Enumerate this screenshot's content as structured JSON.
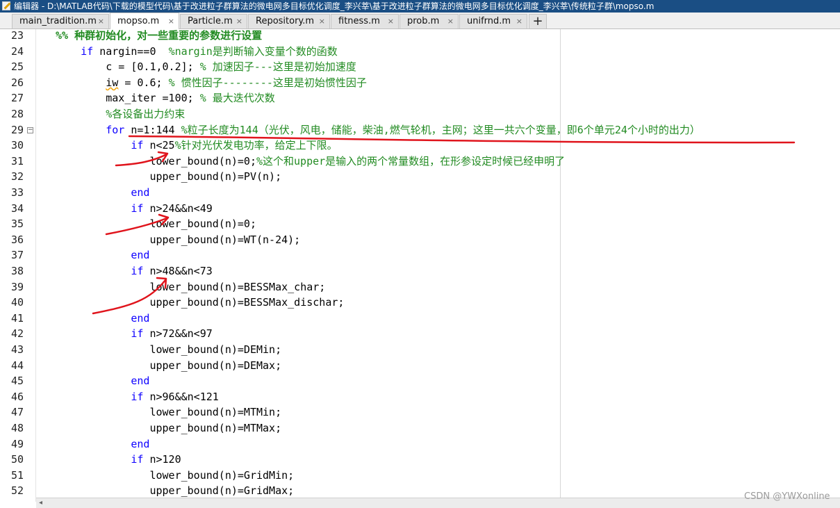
{
  "window": {
    "title": "编辑器 - D:\\MATLAB代码\\下载的模型代码\\基于改进粒子群算法的微电网多目标优化调度_李兴莘\\基于改进粒子群算法的微电网多目标优化调度_李兴莘\\传统粒子群\\mopso.m"
  },
  "tabs": [
    {
      "label": "main_tradition.m",
      "close": "×",
      "active": false
    },
    {
      "label": "mopso.m",
      "close": "×",
      "active": true
    },
    {
      "label": "Particle.m",
      "close": "×",
      "active": false
    },
    {
      "label": "Repository.m",
      "close": "×",
      "active": false
    },
    {
      "label": "fitness.m",
      "close": "×",
      "active": false
    },
    {
      "label": "prob.m",
      "close": "×",
      "active": false
    },
    {
      "label": "unifrnd.m",
      "close": "×",
      "active": false
    }
  ],
  "add_tab_label": "+",
  "lines": [
    {
      "num": "23",
      "segs": [
        {
          "t": "%% 种群初始化，对一些重要的参数进行设置",
          "c": "sec"
        }
      ]
    },
    {
      "num": "24",
      "segs": [
        {
          "t": "    ",
          "c": ""
        },
        {
          "t": "if",
          "c": "kw"
        },
        {
          "t": " nargin==0  ",
          "c": ""
        },
        {
          "t": "%nargin是判断输入变量个数的函数",
          "c": "cm"
        }
      ]
    },
    {
      "num": "25",
      "segs": [
        {
          "t": "        c = [0.1,0.2]; ",
          "c": ""
        },
        {
          "t": "% 加速因子---这里是初始加速度",
          "c": "cm"
        }
      ]
    },
    {
      "num": "26",
      "segs": [
        {
          "t": "        ",
          "c": ""
        },
        {
          "t": "iw",
          "c": "squig"
        },
        {
          "t": " = 0.6; ",
          "c": ""
        },
        {
          "t": "% 惯性因子--------这里是初始惯性因子",
          "c": "cm"
        }
      ]
    },
    {
      "num": "27",
      "segs": [
        {
          "t": "        max_iter =100; ",
          "c": ""
        },
        {
          "t": "% 最大迭代次数",
          "c": "cm"
        }
      ]
    },
    {
      "num": "28",
      "segs": [
        {
          "t": "        ",
          "c": ""
        },
        {
          "t": "%各设备出力约束",
          "c": "cm"
        }
      ]
    },
    {
      "num": "29",
      "fold": "−",
      "segs": [
        {
          "t": "        ",
          "c": ""
        },
        {
          "t": "for",
          "c": "kw"
        },
        {
          "t": " n=1:144 ",
          "c": ""
        },
        {
          "t": "%粒子长度为144（光伏，风电，储能，柴油,燃气轮机，主网；这里一共六个变量，即6个单元24个小时的出力）",
          "c": "cm"
        }
      ]
    },
    {
      "num": "30",
      "segs": [
        {
          "t": "            ",
          "c": ""
        },
        {
          "t": "if",
          "c": "kw"
        },
        {
          "t": " n<25",
          "c": ""
        },
        {
          "t": "%针对光伏发电功率，给定上下限。",
          "c": "cm"
        }
      ]
    },
    {
      "num": "31",
      "segs": [
        {
          "t": "               lower_bound(n)=0;",
          "c": ""
        },
        {
          "t": "%这个和upper是输入的两个常量数组，在形参设定时候已经申明了",
          "c": "cm"
        }
      ]
    },
    {
      "num": "32",
      "segs": [
        {
          "t": "               upper_bound(n)=PV(n);",
          "c": ""
        }
      ]
    },
    {
      "num": "33",
      "segs": [
        {
          "t": "            ",
          "c": ""
        },
        {
          "t": "end",
          "c": "kw"
        }
      ]
    },
    {
      "num": "34",
      "segs": [
        {
          "t": "            ",
          "c": ""
        },
        {
          "t": "if",
          "c": "kw"
        },
        {
          "t": " n>24&&n<49",
          "c": ""
        }
      ]
    },
    {
      "num": "35",
      "segs": [
        {
          "t": "               lower_bound(n)=0;",
          "c": ""
        }
      ]
    },
    {
      "num": "36",
      "segs": [
        {
          "t": "               upper_bound(n)=WT(n-24);",
          "c": ""
        }
      ]
    },
    {
      "num": "37",
      "segs": [
        {
          "t": "            ",
          "c": ""
        },
        {
          "t": "end",
          "c": "kw"
        }
      ]
    },
    {
      "num": "38",
      "segs": [
        {
          "t": "            ",
          "c": ""
        },
        {
          "t": "if",
          "c": "kw"
        },
        {
          "t": " n>48&&n<73",
          "c": ""
        }
      ]
    },
    {
      "num": "39",
      "segs": [
        {
          "t": "               lower_bound(n)=BESSMax_char;",
          "c": ""
        }
      ]
    },
    {
      "num": "40",
      "segs": [
        {
          "t": "               upper_bound(n)=BESSMax_dischar;",
          "c": ""
        }
      ]
    },
    {
      "num": "41",
      "segs": [
        {
          "t": "            ",
          "c": ""
        },
        {
          "t": "end",
          "c": "kw"
        }
      ]
    },
    {
      "num": "42",
      "segs": [
        {
          "t": "            ",
          "c": ""
        },
        {
          "t": "if",
          "c": "kw"
        },
        {
          "t": " n>72&&n<97",
          "c": ""
        }
      ]
    },
    {
      "num": "43",
      "segs": [
        {
          "t": "               lower_bound(n)=DEMin;",
          "c": ""
        }
      ]
    },
    {
      "num": "44",
      "segs": [
        {
          "t": "               upper_bound(n)=DEMax;",
          "c": ""
        }
      ]
    },
    {
      "num": "45",
      "segs": [
        {
          "t": "            ",
          "c": ""
        },
        {
          "t": "end",
          "c": "kw"
        }
      ]
    },
    {
      "num": "46",
      "segs": [
        {
          "t": "            ",
          "c": ""
        },
        {
          "t": "if",
          "c": "kw"
        },
        {
          "t": " n>96&&n<121",
          "c": ""
        }
      ]
    },
    {
      "num": "47",
      "segs": [
        {
          "t": "               lower_bound(n)=MTMin;",
          "c": ""
        }
      ]
    },
    {
      "num": "48",
      "segs": [
        {
          "t": "               upper_bound(n)=MTMax;",
          "c": ""
        }
      ]
    },
    {
      "num": "49",
      "segs": [
        {
          "t": "            ",
          "c": ""
        },
        {
          "t": "end",
          "c": "kw"
        }
      ]
    },
    {
      "num": "50",
      "segs": [
        {
          "t": "            ",
          "c": ""
        },
        {
          "t": "if",
          "c": "kw"
        },
        {
          "t": " n>120",
          "c": ""
        }
      ]
    },
    {
      "num": "51",
      "segs": [
        {
          "t": "               lower_bound(n)=GridMin;",
          "c": ""
        }
      ]
    },
    {
      "num": "52",
      "segs": [
        {
          "t": "               upper_bound(n)=GridMax;",
          "c": ""
        }
      ]
    }
  ],
  "scroll_left_arrow": "◂",
  "watermark": "CSDN @YWXonline"
}
